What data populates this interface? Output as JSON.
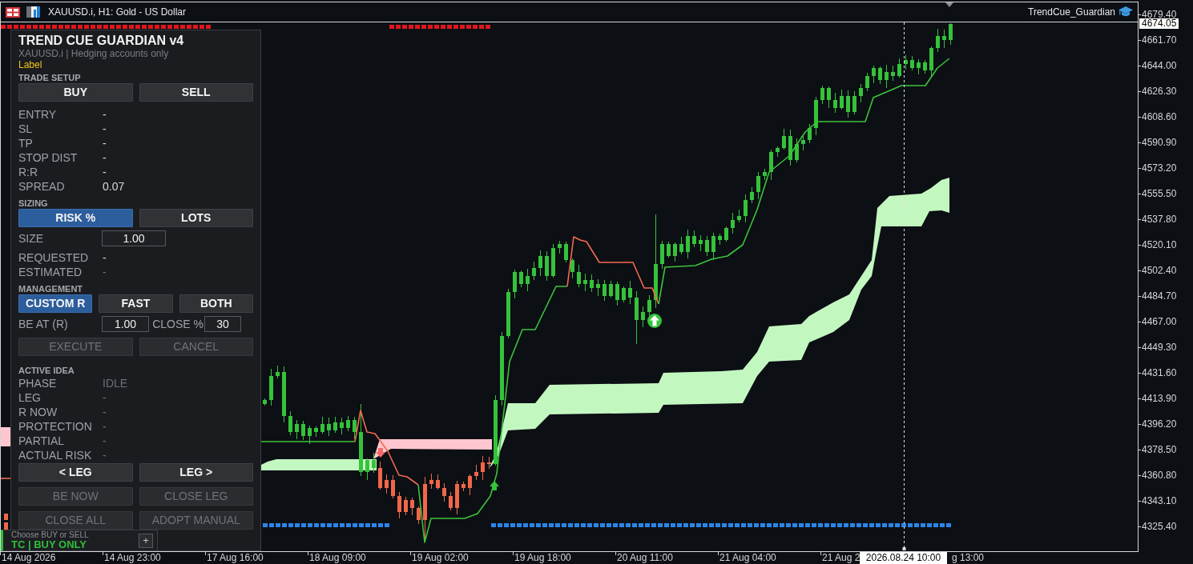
{
  "window": {
    "title": "XAUUSD.i, H1: Gold - US Dollar",
    "expert": "TrendCue_Guardian"
  },
  "panel": {
    "title": "TREND CUE GUARDIAN v4",
    "subtitle": "XAUUSD.i | Hedging accounts only",
    "label": "Label",
    "items": [
      {
        "kind": "heading",
        "text": "TRADE SETUP"
      },
      {
        "kind": "buttons",
        "buttons": [
          {
            "label": "BUY",
            "selected": false,
            "disabled": false
          },
          {
            "label": "SELL",
            "selected": false,
            "disabled": false
          }
        ]
      },
      {
        "kind": "readout",
        "label": "ENTRY",
        "value": "-",
        "muted": false
      },
      {
        "kind": "readout",
        "label": "SL",
        "value": "-",
        "muted": false
      },
      {
        "kind": "readout",
        "label": "TP",
        "value": "-",
        "muted": false
      },
      {
        "kind": "readout",
        "label": "STOP DIST",
        "value": "-",
        "muted": false
      },
      {
        "kind": "readout",
        "label": "R:R",
        "value": "-",
        "muted": false
      },
      {
        "kind": "readout",
        "label": "SPREAD",
        "value": "0.07",
        "muted": false
      },
      {
        "kind": "heading",
        "text": "SIZING"
      },
      {
        "kind": "buttons",
        "buttons": [
          {
            "label": "RISK %",
            "selected": true,
            "disabled": false
          },
          {
            "label": "LOTS",
            "selected": false,
            "disabled": false
          }
        ]
      },
      {
        "kind": "input",
        "label": "SIZE",
        "value": "1.00"
      },
      {
        "kind": "readout",
        "label": "REQUESTED",
        "value": "-",
        "muted": false
      },
      {
        "kind": "readout",
        "label": "ESTIMATED",
        "value": "-",
        "muted": true
      },
      {
        "kind": "heading",
        "text": "MANAGEMENT"
      },
      {
        "kind": "buttons",
        "buttons": [
          {
            "label": "CUSTOM R",
            "selected": true,
            "disabled": false
          },
          {
            "label": "FAST",
            "selected": false,
            "disabled": false
          },
          {
            "label": "BOTH",
            "selected": false,
            "disabled": false
          }
        ]
      },
      {
        "kind": "input_pair",
        "fields": [
          {
            "label": "BE AT (R)",
            "value": "1.00"
          },
          {
            "label": "CLOSE %",
            "value": "30"
          }
        ]
      },
      {
        "kind": "buttons",
        "buttons": [
          {
            "label": "EXECUTE",
            "disabled": true
          },
          {
            "label": "CANCEL",
            "disabled": true
          }
        ]
      },
      {
        "kind": "heading",
        "text": "ACTIVE IDEA"
      },
      {
        "kind": "readout",
        "label": "PHASE",
        "value": "IDLE",
        "muted": true
      },
      {
        "kind": "readout",
        "label": "LEG",
        "value": "-",
        "muted": true
      },
      {
        "kind": "readout",
        "label": "R NOW",
        "value": "-",
        "muted": true
      },
      {
        "kind": "readout",
        "label": "PROTECTION",
        "value": "-",
        "muted": true
      },
      {
        "kind": "readout",
        "label": "PARTIAL",
        "value": "-",
        "muted": true
      },
      {
        "kind": "readout",
        "label": "ACTUAL RISK",
        "value": "-",
        "muted": true
      },
      {
        "kind": "buttons",
        "buttons": [
          {
            "label": "< LEG",
            "disabled": false
          },
          {
            "label": "LEG >",
            "disabled": false
          }
        ]
      },
      {
        "kind": "buttons",
        "buttons": [
          {
            "label": "BE NOW",
            "disabled": true
          },
          {
            "label": "CLOSE LEG",
            "disabled": true
          }
        ]
      },
      {
        "kind": "buttons",
        "buttons": [
          {
            "label": "CLOSE ALL",
            "disabled": true
          },
          {
            "label": "ADOPT MANUAL",
            "disabled": true
          }
        ]
      }
    ]
  },
  "status_badge": {
    "hint": "Choose BUY or SELL",
    "mode": "TC | BUY ONLY",
    "button": "+"
  },
  "price_axis": {
    "labels": [
      "4679.40",
      "4661.70",
      "4644.00",
      "4626.30",
      "4608.60",
      "4590.90",
      "4573.20",
      "4555.50",
      "4537.80",
      "4520.10",
      "4502.40",
      "4484.70",
      "4467.00",
      "4449.30",
      "4431.60",
      "4413.90",
      "4396.20",
      "4378.50",
      "4360.80",
      "4343.10",
      "4325.40"
    ],
    "current_price": "4674.05"
  },
  "time_axis": {
    "labels": [
      "14 Aug 2026",
      "14 Aug 23:00",
      "17 Aug 16:00",
      "18 Aug 09:00",
      "19 Aug 02:00",
      "19 Aug 18:00",
      "20 Aug 11:00",
      "21 Aug 04:00",
      "21 Aug 2",
      "g 13:00"
    ],
    "crosshair_time": "2026.08.24 10:00"
  }
}
